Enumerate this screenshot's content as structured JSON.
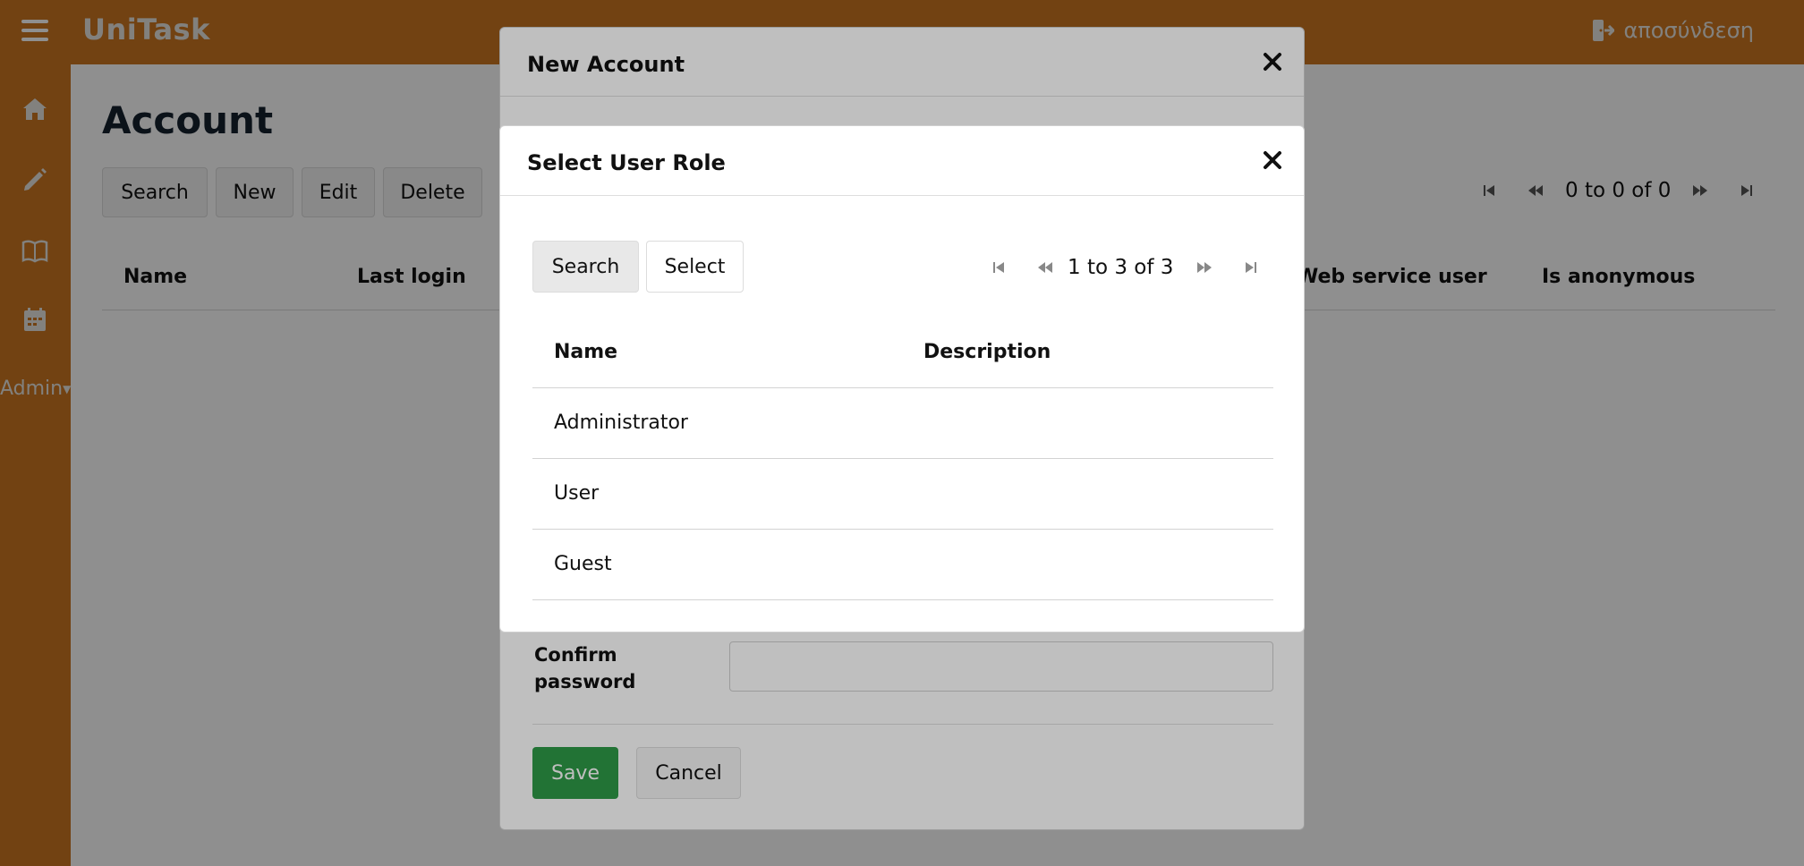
{
  "app": {
    "brand": "UniTask",
    "logout_label": "αποσύνδεση"
  },
  "sidebar": {
    "admin_label": "Admin"
  },
  "page": {
    "title": "Account",
    "toolbar": {
      "search": "Search",
      "new": "New",
      "edit": "Edit",
      "delete": "Delete"
    },
    "pager_text": "0 to 0 of 0",
    "columns": [
      "Name",
      "Last login",
      "Web service user",
      "Is anonymous"
    ]
  },
  "new_account_modal": {
    "title": "New Account",
    "confirm_password_label": "Confirm password",
    "save": "Save",
    "cancel": "Cancel"
  },
  "select_role_modal": {
    "title": "Select User Role",
    "search": "Search",
    "select": "Select",
    "pager_text": "1 to 3 of 3",
    "columns": [
      "Name",
      "Description"
    ],
    "rows": [
      {
        "name": "Administrator",
        "description": ""
      },
      {
        "name": "User",
        "description": ""
      },
      {
        "name": "Guest",
        "description": ""
      }
    ]
  },
  "colors": {
    "brand": "#cc7722",
    "save": "#2e9a47"
  }
}
